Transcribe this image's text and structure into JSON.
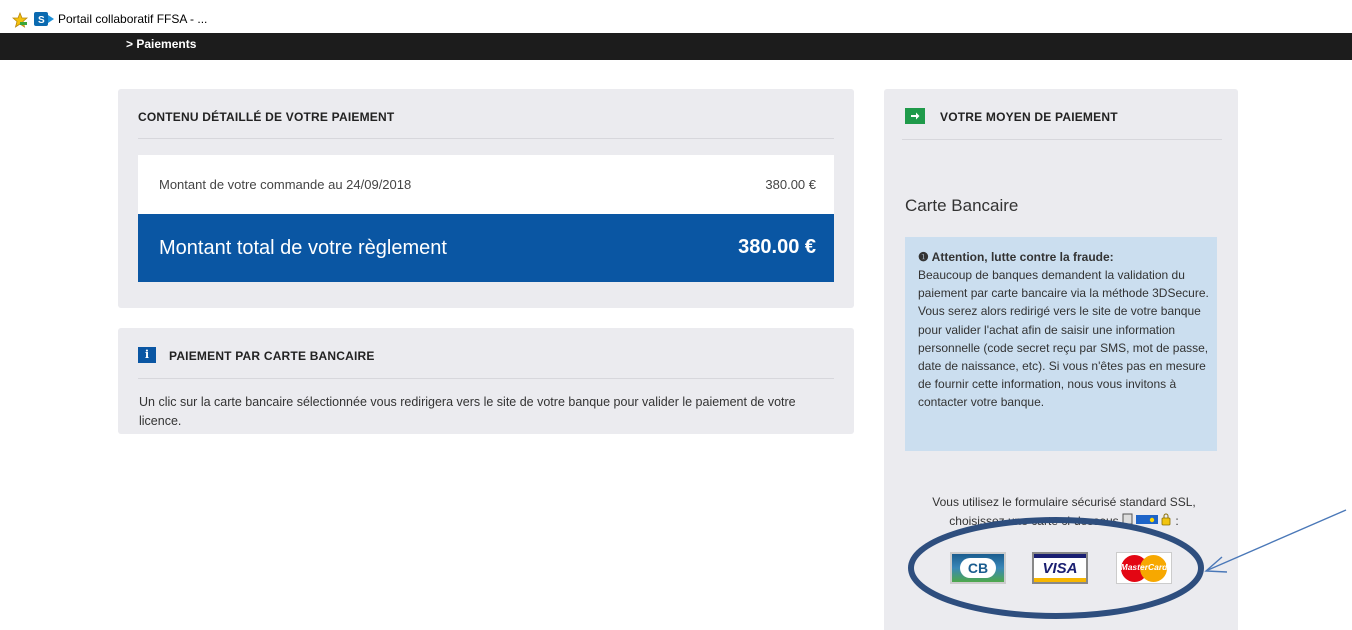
{
  "favorites": {
    "tab_title": "Portail collaboratif FFSA - ...",
    "star_icon": "favorites-star-icon",
    "site_icon": "sharepoint-icon"
  },
  "nav": {
    "breadcrumb": "> Paiements"
  },
  "detail": {
    "title": "CONTENU DÉTAILLÉ DE VOTRE PAIEMENT",
    "order_label": "Montant de votre commande au 24/09/2018",
    "order_value": "380.00 €",
    "total_label": "Montant total de votre règlement",
    "total_value": "380.00 €"
  },
  "card_payment": {
    "badge": "i",
    "title": "PAIEMENT PAR CARTE BANCAIRE",
    "description": "Un clic sur la carte bancaire sélectionnée vous redirigera vers le site de votre banque pour valider le paiement de votre licence."
  },
  "payment_method": {
    "title": "VOTRE MOYEN DE PAIEMENT",
    "heading": "Carte Bancaire",
    "alert_title": "Attention, lutte contre la fraude:",
    "alert_body": "Beaucoup de banques demandent la validation du paiement par carte bancaire via la méthode 3DSecure. Vous serez alors redirigé vers le site de votre banque pour valider l'achat afin de saisir une information personnelle (code secret reçu par SMS, mot de passe, date de naissance, etc). Si vous n'êtes pas en mesure de fournir cette information, nous vous invitons à contacter votre banque.",
    "ssl_line1": "Vous utilisez le formulaire sécurisé standard SSL,",
    "ssl_line2": "choisissez une carte ci-dessous",
    "ssl_end": ":",
    "cards": [
      {
        "name": "CB",
        "label": "CB"
      },
      {
        "name": "VISA",
        "label": "VISA"
      },
      {
        "name": "MasterCard",
        "label": "MasterCard"
      }
    ]
  },
  "colors": {
    "nav_bg": "#1c1c1c",
    "panel_bg": "#ebebef",
    "total_bg": "#0a56a3",
    "alert_bg": "#cbdeef",
    "annotation": "#2e4e7e",
    "arrow_badge": "#1f9a4a"
  }
}
